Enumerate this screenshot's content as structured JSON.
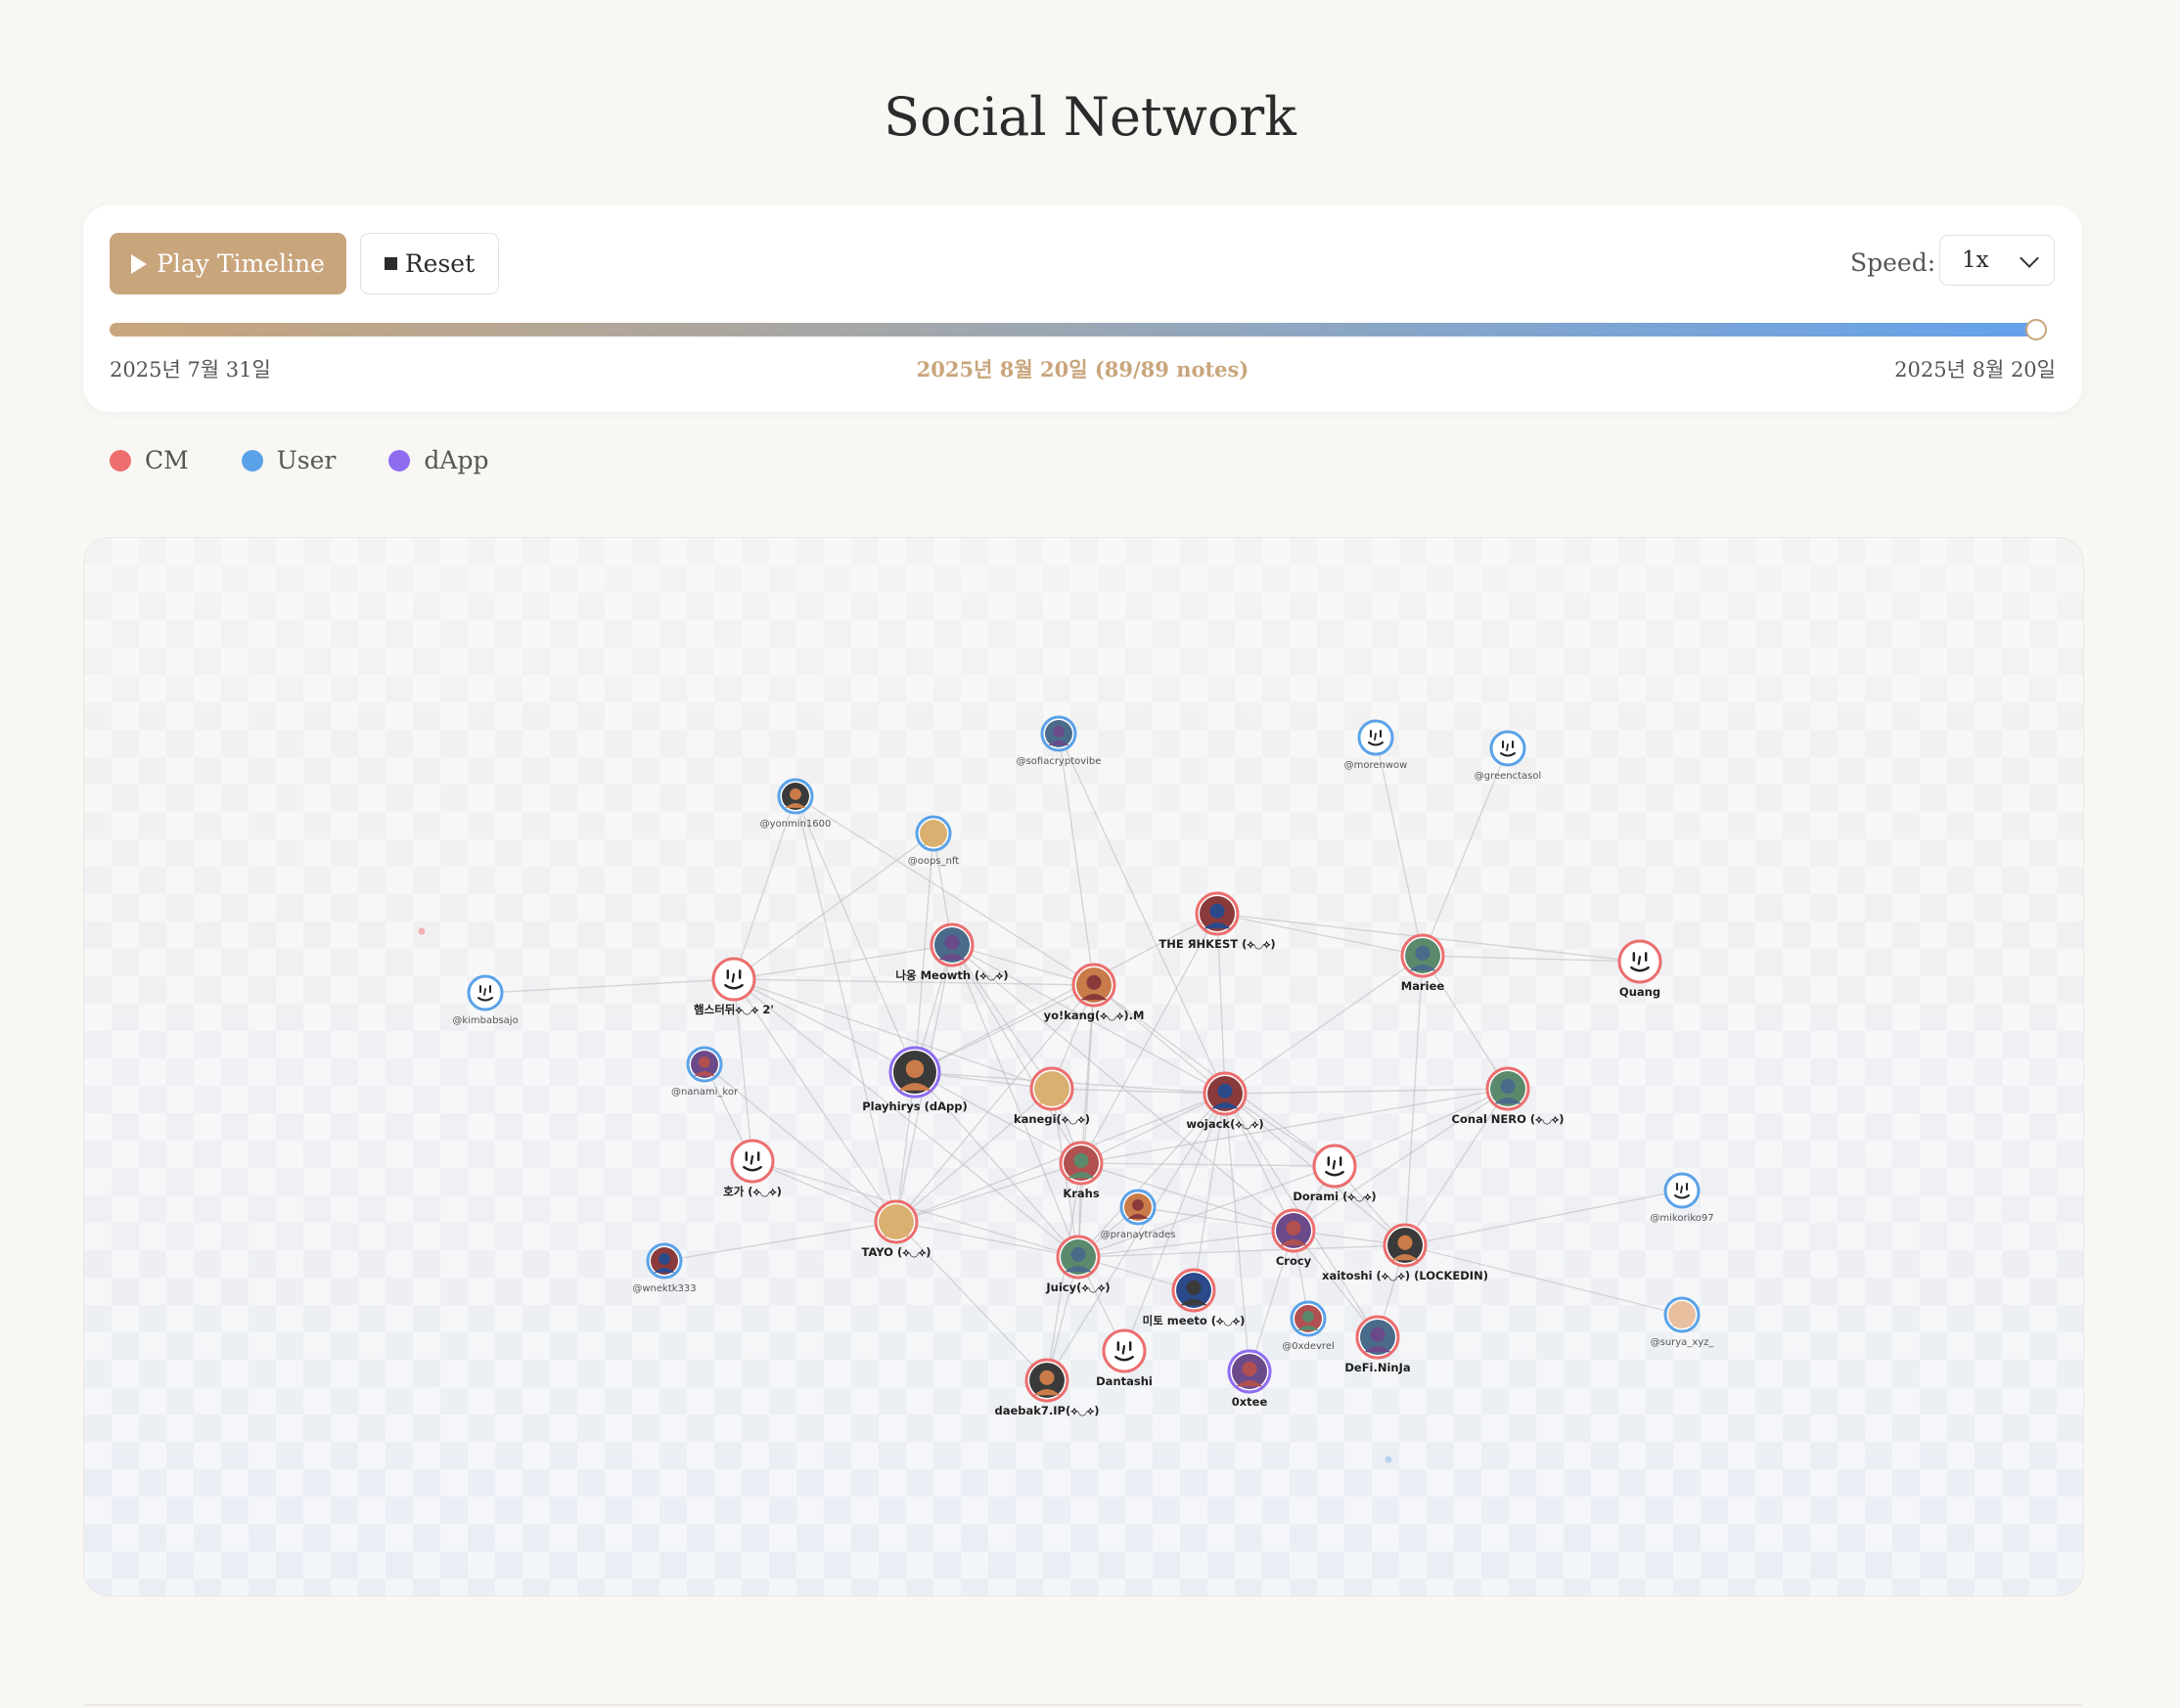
{
  "page": {
    "title": "Social Network"
  },
  "controls": {
    "play_label": "Play Timeline",
    "reset_label": "Reset",
    "speed_label": "Speed:",
    "speed_value": "1x",
    "progress": 1.0,
    "start_date": "2025년 7월 31일",
    "current_status": "2025년 8월 20일 (89/89 notes)",
    "end_date": "2025년 8월 20일"
  },
  "legend": [
    {
      "label": "CM",
      "color": "#ec6e6e"
    },
    {
      "label": "User",
      "color": "#5aa2e8"
    },
    {
      "label": "dApp",
      "color": "#8e6cf0"
    }
  ],
  "graph": {
    "nodes": [
      {
        "id": "sofiacryptovibe",
        "label": "@sofiacryptovibe",
        "type": "User",
        "icon": "avatar-photo-icon"
      },
      {
        "id": "morenwow",
        "label": "@morenwow",
        "type": "User",
        "icon": "default-face-icon"
      },
      {
        "id": "greenctasol",
        "label": "@greenctasol",
        "type": "User",
        "icon": "default-face-icon"
      },
      {
        "id": "yonmin1600",
        "label": "@yonmin1600",
        "type": "User",
        "icon": "avatar-photo-icon"
      },
      {
        "id": "oops_nft",
        "label": "@oops_nft",
        "type": "User",
        "icon": "avatar-photo-icon"
      },
      {
        "id": "rhkest",
        "label": "THE ЯHKEST (⟡◡⟡)",
        "type": "CM",
        "icon": "avatar-photo-icon"
      },
      {
        "id": "mariee",
        "label": "Mariee",
        "type": "CM",
        "icon": "avatar-photo-icon"
      },
      {
        "id": "quang",
        "label": "Quang",
        "type": "CM",
        "icon": "default-face-icon"
      },
      {
        "id": "kimbabsajo",
        "label": "@kimbabsajo",
        "type": "User",
        "icon": "default-face-icon"
      },
      {
        "id": "hamster",
        "label": "햄스터뒤⟡◡⟡ 2'",
        "type": "CM",
        "icon": "default-face-icon"
      },
      {
        "id": "meowth",
        "label": "나옹 Meowth (⟡◡⟡)",
        "type": "CM",
        "icon": "avatar-photo-icon"
      },
      {
        "id": "yokang",
        "label": "yo!kang(⟡◡⟡).M",
        "type": "CM",
        "icon": "avatar-photo-icon"
      },
      {
        "id": "nanami_kor",
        "label": "@nanami_kor",
        "type": "User",
        "icon": "avatar-photo-icon"
      },
      {
        "id": "playhirys",
        "label": "Playhirys (dApp)",
        "type": "dApp",
        "icon": "avatar-photo-icon"
      },
      {
        "id": "kanegi",
        "label": "kanegi(⟡◡⟡)",
        "type": "CM",
        "icon": "avatar-photo-icon"
      },
      {
        "id": "wojack",
        "label": "wojack(⟡◡⟡)",
        "type": "CM",
        "icon": "avatar-photo-icon"
      },
      {
        "id": "conal",
        "label": "Conal NERO (⟡◡⟡)",
        "type": "CM",
        "icon": "avatar-photo-icon"
      },
      {
        "id": "hoga",
        "label": "호가 (⟡◡⟡)",
        "type": "CM",
        "icon": "default-face-icon"
      },
      {
        "id": "krahs",
        "label": "Krahs",
        "type": "CM",
        "icon": "avatar-photo-icon"
      },
      {
        "id": "dorami",
        "label": "Dorami (⟡◡⟡)",
        "type": "CM",
        "icon": "default-face-icon"
      },
      {
        "id": "mikoriko97",
        "label": "@mikoriko97",
        "type": "User",
        "icon": "default-face-icon"
      },
      {
        "id": "pranaytrades",
        "label": "@pranaytrades",
        "type": "User",
        "icon": "avatar-photo-icon"
      },
      {
        "id": "crocy",
        "label": "Crocy",
        "type": "CM",
        "icon": "avatar-photo-icon"
      },
      {
        "id": "xaitoshi",
        "label": "xaitoshi (⟡◡⟡) (LOCKEDIN)",
        "type": "CM",
        "icon": "avatar-photo-icon"
      },
      {
        "id": "tayo",
        "label": "TAYO (⟡◡⟡)",
        "type": "CM",
        "icon": "avatar-photo-icon"
      },
      {
        "id": "wnektk333",
        "label": "@wnektk333",
        "type": "User",
        "icon": "avatar-photo-icon"
      },
      {
        "id": "juicy",
        "label": "Juicy(⟡◡⟡)",
        "type": "CM",
        "icon": "avatar-photo-icon"
      },
      {
        "id": "meeto",
        "label": "미토 meeto (⟡◡⟡)",
        "type": "CM",
        "icon": "avatar-photo-icon"
      },
      {
        "id": "0xdevrel",
        "label": "@0xdevrel",
        "type": "User",
        "icon": "avatar-photo-icon"
      },
      {
        "id": "surya",
        "label": "@surya_xyz_",
        "type": "User",
        "icon": "avatar-photo-icon"
      },
      {
        "id": "defininja",
        "label": "DeFi.NinJa",
        "type": "CM",
        "icon": "avatar-photo-icon"
      },
      {
        "id": "dantashi",
        "label": "Dantashi",
        "type": "CM",
        "icon": "default-face-icon"
      },
      {
        "id": "0xtee",
        "label": "0xtee",
        "type": "dApp",
        "icon": "avatar-photo-icon"
      },
      {
        "id": "daebak",
        "label": "daebak7.IP(⟡◡⟡)",
        "type": "CM",
        "icon": "avatar-photo-icon"
      }
    ],
    "edges": [
      [
        "sofiacryptovibe",
        "yokang"
      ],
      [
        "sofiacryptovibe",
        "wojack"
      ],
      [
        "morenwow",
        "mariee"
      ],
      [
        "greenctasol",
        "mariee"
      ],
      [
        "yonmin1600",
        "hamster"
      ],
      [
        "yonmin1600",
        "playhirys"
      ],
      [
        "yonmin1600",
        "yokang"
      ],
      [
        "yonmin1600",
        "tayo"
      ],
      [
        "oops_nft",
        "hamster"
      ],
      [
        "oops_nft",
        "playhirys"
      ],
      [
        "oops_nft",
        "meowth"
      ],
      [
        "rhkest",
        "mariee"
      ],
      [
        "rhkest",
        "wojack"
      ],
      [
        "rhkest",
        "krahs"
      ],
      [
        "rhkest",
        "playhirys"
      ],
      [
        "rhkest",
        "quang"
      ],
      [
        "mariee",
        "quang"
      ],
      [
        "mariee",
        "wojack"
      ],
      [
        "mariee",
        "xaitoshi"
      ],
      [
        "mariee",
        "conal"
      ],
      [
        "kimbabsajo",
        "hamster"
      ],
      [
        "hamster",
        "meowth"
      ],
      [
        "hamster",
        "yokang"
      ],
      [
        "hamster",
        "playhirys"
      ],
      [
        "hamster",
        "kanegi"
      ],
      [
        "hamster",
        "tayo"
      ],
      [
        "hamster",
        "hoga"
      ],
      [
        "hamster",
        "juicy"
      ],
      [
        "meowth",
        "yokang"
      ],
      [
        "meowth",
        "playhirys"
      ],
      [
        "meowth",
        "kanegi"
      ],
      [
        "meowth",
        "wojack"
      ],
      [
        "meowth",
        "krahs"
      ],
      [
        "meowth",
        "juicy"
      ],
      [
        "meowth",
        "tayo"
      ],
      [
        "meowth",
        "crocy"
      ],
      [
        "yokang",
        "playhirys"
      ],
      [
        "yokang",
        "kanegi"
      ],
      [
        "yokang",
        "wojack"
      ],
      [
        "yokang",
        "krahs"
      ],
      [
        "yokang",
        "juicy"
      ],
      [
        "yokang",
        "tayo"
      ],
      [
        "yokang",
        "dorami"
      ],
      [
        "nanami_kor",
        "hoga"
      ],
      [
        "nanami_kor",
        "tayo"
      ],
      [
        "playhirys",
        "kanegi"
      ],
      [
        "playhirys",
        "wojack"
      ],
      [
        "playhirys",
        "tayo"
      ],
      [
        "playhirys",
        "juicy"
      ],
      [
        "playhirys",
        "krahs"
      ],
      [
        "kanegi",
        "wojack"
      ],
      [
        "kanegi",
        "krahs"
      ],
      [
        "kanegi",
        "juicy"
      ],
      [
        "kanegi",
        "tayo"
      ],
      [
        "wojack",
        "conal"
      ],
      [
        "wojack",
        "dorami"
      ],
      [
        "wojack",
        "krahs"
      ],
      [
        "wojack",
        "crocy"
      ],
      [
        "wojack",
        "xaitoshi"
      ],
      [
        "wojack",
        "juicy"
      ],
      [
        "wojack",
        "meeto"
      ],
      [
        "wojack",
        "tayo"
      ],
      [
        "wojack",
        "daebak"
      ],
      [
        "wojack",
        "0xtee"
      ],
      [
        "wojack",
        "defininja"
      ],
      [
        "wojack",
        "dantashi"
      ],
      [
        "conal",
        "dorami"
      ],
      [
        "conal",
        "xaitoshi"
      ],
      [
        "conal",
        "crocy"
      ],
      [
        "conal",
        "krahs"
      ],
      [
        "hoga",
        "tayo"
      ],
      [
        "hoga",
        "juicy"
      ],
      [
        "krahs",
        "juicy"
      ],
      [
        "krahs",
        "tayo"
      ],
      [
        "krahs",
        "crocy"
      ],
      [
        "krahs",
        "dorami"
      ],
      [
        "krahs",
        "daebak"
      ],
      [
        "dorami",
        "crocy"
      ],
      [
        "dorami",
        "xaitoshi"
      ],
      [
        "dorami",
        "juicy"
      ],
      [
        "mikoriko97",
        "xaitoshi"
      ],
      [
        "pranaytrades",
        "juicy"
      ],
      [
        "pranaytrades",
        "crocy"
      ],
      [
        "crocy",
        "xaitoshi"
      ],
      [
        "crocy",
        "juicy"
      ],
      [
        "crocy",
        "defininja"
      ],
      [
        "crocy",
        "0xtee"
      ],
      [
        "crocy",
        "0xdevrel"
      ],
      [
        "xaitoshi",
        "surya"
      ],
      [
        "xaitoshi",
        "juicy"
      ],
      [
        "xaitoshi",
        "defininja"
      ],
      [
        "tayo",
        "wnektk333"
      ],
      [
        "tayo",
        "juicy"
      ],
      [
        "tayo",
        "daebak"
      ],
      [
        "juicy",
        "meeto"
      ],
      [
        "juicy",
        "daebak"
      ],
      [
        "juicy",
        "dantashi"
      ]
    ]
  }
}
